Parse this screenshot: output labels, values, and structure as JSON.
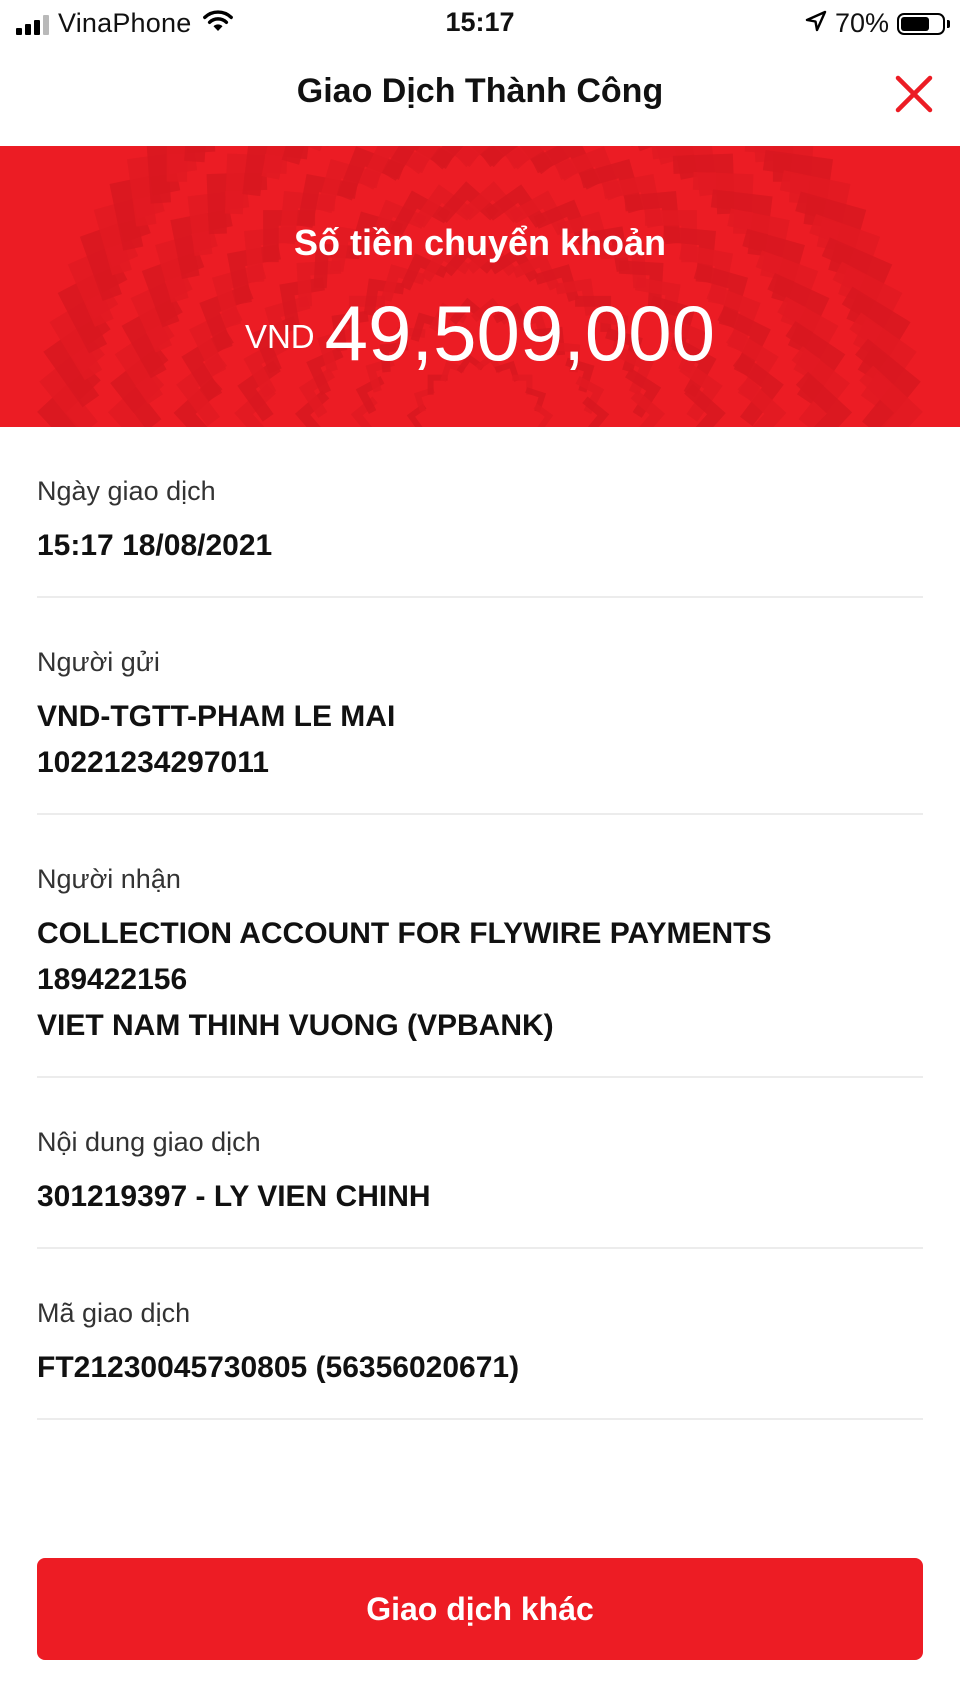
{
  "status_bar": {
    "carrier": "VinaPhone",
    "time": "15:17",
    "battery_percent": "70%",
    "battery_level": 0.7,
    "signal_bars_active": 3,
    "signal_bars_total": 4,
    "icons": [
      "signal-icon",
      "wifi-icon",
      "location-arrow-icon",
      "battery-icon"
    ]
  },
  "header": {
    "title": "Giao Dịch Thành Công",
    "close_icon": "close-icon",
    "close_color": "#ec1c24"
  },
  "banner": {
    "label": "Số tiền chuyển khoản",
    "currency": "VND",
    "amount": "49,509,000",
    "background_color": "#ec1c24"
  },
  "details": {
    "date": {
      "label": "Ngày giao dịch",
      "value": "15:17 18/08/2021"
    },
    "sender": {
      "label": "Người gửi",
      "lines": [
        "VND-TGTT-PHAM LE MAI",
        "10221234297011"
      ]
    },
    "recipient": {
      "label": "Người nhận",
      "lines": [
        "COLLECTION ACCOUNT FOR FLYWIRE PAYMENTS",
        "189422156",
        "VIET NAM THINH VUONG (VPBANK)"
      ]
    },
    "content": {
      "label": "Nội dung giao dịch",
      "value": "301219397 - LY VIEN CHINH"
    },
    "transaction_id": {
      "label": "Mã giao dịch",
      "value": "FT21230045730805 (56356020671)"
    }
  },
  "actions": {
    "other_transaction_label": "Giao dịch khác",
    "button_color": "#ed1c24"
  }
}
